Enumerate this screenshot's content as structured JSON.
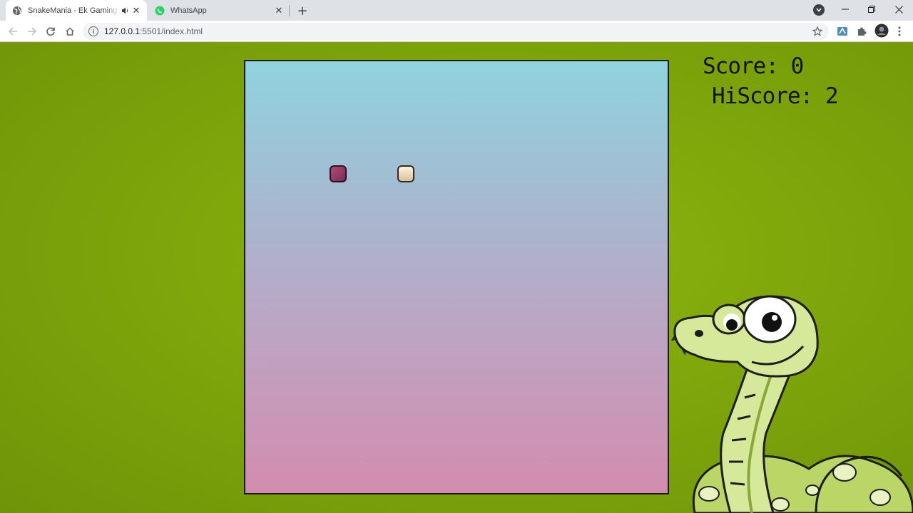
{
  "browser": {
    "tabs": [
      {
        "title": "SnakeMania - Ek Gaming Katha",
        "active": true,
        "audio": true
      },
      {
        "title": "WhatsApp",
        "active": false,
        "audio": false
      }
    ],
    "address": {
      "host": "127.0.0.1",
      "path": ":5501/index.html"
    }
  },
  "game": {
    "score_label": "Score: 0",
    "hiscore_label": "HiScore: 2"
  },
  "colors": {
    "page_bg": "#7da30a",
    "board_top": "#8fd3df",
    "board_bottom": "#d48cae",
    "food": "#9b3d68",
    "snake_head": "#f0e4c8"
  }
}
